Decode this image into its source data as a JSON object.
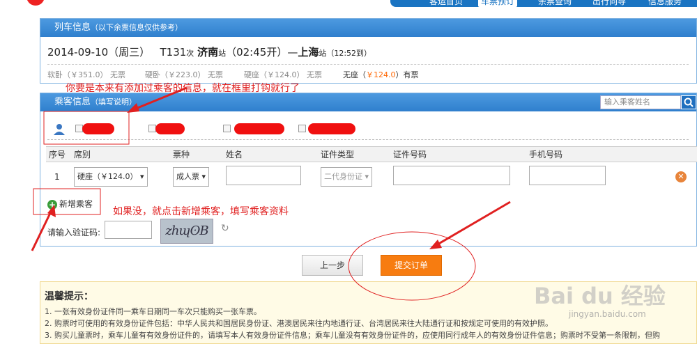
{
  "nav": {
    "items": [
      "客运首页",
      "车票预订",
      "余票查询",
      "出行向导",
      "信息服务"
    ],
    "active_index": 1
  },
  "train_panel": {
    "title": "列车信息",
    "subtitle": "（以下余票信息仅供参考）",
    "date": "2014-09-10（周三）",
    "train_no": "T131",
    "train_suffix": "次",
    "from": "济南",
    "from_suffix": "站",
    "depart": "（02:45开）",
    "dash": "—",
    "to": "上海",
    "to_suffix": "站",
    "arrive": "（12:52到）",
    "seats": [
      {
        "name": "软卧（￥351.0）",
        "status": "无票"
      },
      {
        "name": "硬卧（￥223.0）",
        "status": "无票"
      },
      {
        "name": "硬座（￥124.0）",
        "status": "无票"
      }
    ],
    "seat_avail": {
      "name": "无座（",
      "price": "￥124.0",
      "close": "）",
      "status": "有票"
    }
  },
  "passenger_panel": {
    "title": "乘客信息",
    "subtitle": "（填写说明）",
    "search_placeholder": "输入乘客姓名",
    "columns": [
      "序号",
      "席别",
      "票种",
      "姓名",
      "证件类型",
      "证件号码",
      "手机号码"
    ],
    "row": {
      "index": "1",
      "seat": "硬座（￥124.0）",
      "ticket_type": "成人票",
      "id_type": "二代身份证"
    },
    "add_label": "新增乘客",
    "captcha_label": "请输入验证码:",
    "captcha_text": "zhɰʘB"
  },
  "buttons": {
    "back": "上一步",
    "submit": "提交订单"
  },
  "tips": {
    "title": "温馨提示：",
    "lines": [
      "1. 一张有效身份证件同一乘车日期同一车次只能购买一张车票。",
      "2. 购票时可使用的有效身份证件包括：中华人民共和国居民身份证、港澳居民来往内地通行证、台湾居民来往大陆通行证和按规定可使用的有效护照。",
      "3. 购买儿童票时，乘车儿童有有效身份证件的，请填写本人有效身份证件信息；乘车儿童没有有效身份证件的，应使用同行成年人的有效身份证件信息；购票时不受第一条限制，但购"
    ]
  },
  "annotations": {
    "note1": "你要是本来有添加过乘客的信息，就在框里打钩就行了",
    "note2": "如果没，就点击新增乘客，填写乘客资料",
    "color": "#e02020"
  },
  "watermark": {
    "brand": "Bai du 经验",
    "url": "jingyan.baidu.com"
  }
}
